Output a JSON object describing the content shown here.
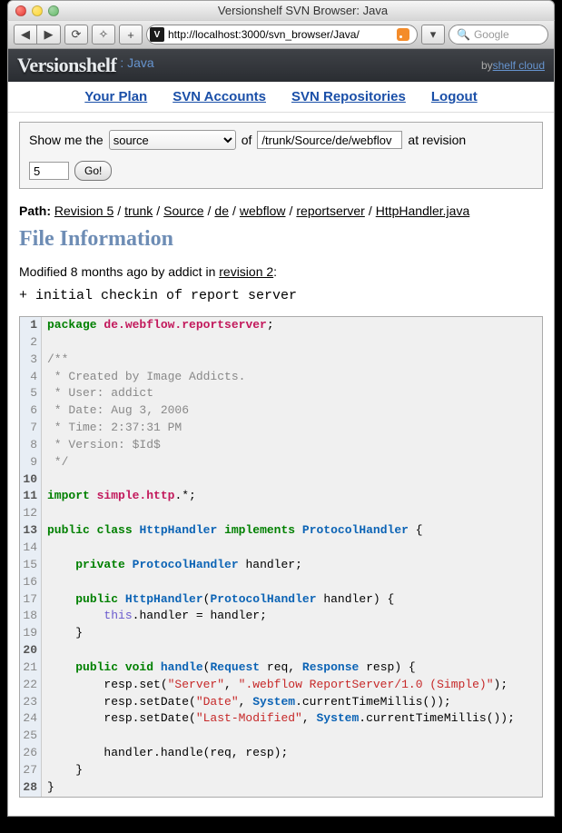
{
  "window": {
    "title": "Versionshelf SVN Browser: Java"
  },
  "toolbar": {
    "url": "http://localhost:3000/svn_browser/Java/",
    "search_placeholder": "Google"
  },
  "header": {
    "logo": "Versionshelf",
    "sub": ": Java",
    "by": "by ",
    "by_link": "shelf cloud"
  },
  "nav": {
    "plan": "Your Plan",
    "accounts": "SVN Accounts",
    "repos": "SVN Repositories",
    "logout": "Logout"
  },
  "filter": {
    "show_me": "Show me the",
    "type_options": [
      "source"
    ],
    "type_selected": "source",
    "of": "of",
    "path_value": "/trunk/Source/de/webflov",
    "at_rev": "at revision",
    "rev_value": "5",
    "go": "Go!"
  },
  "breadcrumb": {
    "label": "Path:",
    "segs": [
      "Revision 5",
      "trunk",
      "Source",
      "de",
      "webflow",
      "reportserver",
      "HttpHandler.java"
    ]
  },
  "section_title": "File Information",
  "meta": {
    "text_before": "Modified 8 months ago by addict in ",
    "rev_link": "revision 2",
    "text_after": ":"
  },
  "commit_msg": "+ initial checkin of report server",
  "code": {
    "bold_lines": [
      1,
      10,
      11,
      13,
      20,
      28
    ],
    "lines": [
      {
        "n": 1,
        "html": "<span class='kw'>package</span> <span class='pkg'>de.webflow.reportserver</span>;"
      },
      {
        "n": 2,
        "html": ""
      },
      {
        "n": 3,
        "html": "<span class='cmnt'>/**</span>"
      },
      {
        "n": 4,
        "html": "<span class='cmnt'> * Created by Image Addicts.</span>"
      },
      {
        "n": 5,
        "html": "<span class='cmnt'> * User: addict</span>"
      },
      {
        "n": 6,
        "html": "<span class='cmnt'> * Date: Aug 3, 2006</span>"
      },
      {
        "n": 7,
        "html": "<span class='cmnt'> * Time: 2:37:31 PM</span>"
      },
      {
        "n": 8,
        "html": "<span class='cmnt'> * Version: $Id$</span>"
      },
      {
        "n": 9,
        "html": "<span class='cmnt'> */</span>"
      },
      {
        "n": 10,
        "html": ""
      },
      {
        "n": 11,
        "html": "<span class='kw'>import</span> <span class='pkg'>simple.http</span>.*;"
      },
      {
        "n": 12,
        "html": ""
      },
      {
        "n": 13,
        "html": "<span class='kw'>public class</span> <span class='type'>HttpHandler</span> <span class='kw'>implements</span> <span class='type'>ProtocolHandler</span> {"
      },
      {
        "n": 14,
        "html": ""
      },
      {
        "n": 15,
        "html": "    <span class='kw'>private</span> <span class='type'>ProtocolHandler</span> handler;"
      },
      {
        "n": 16,
        "html": ""
      },
      {
        "n": 17,
        "html": "    <span class='kw'>public</span> <span class='type'>HttpHandler</span>(<span class='type'>ProtocolHandler</span> handler) {"
      },
      {
        "n": 18,
        "html": "        <span class='self'>this</span>.handler = handler;"
      },
      {
        "n": 19,
        "html": "    }"
      },
      {
        "n": 20,
        "html": ""
      },
      {
        "n": 21,
        "html": "    <span class='kw'>public void</span> <span class='type'>handle</span>(<span class='type'>Request</span> req, <span class='type'>Response</span> resp) {"
      },
      {
        "n": 22,
        "html": "        resp.set(<span class='str'>\"Server\"</span>, <span class='str'>\".webflow ReportServer/1.0 (Simple)\"</span>);"
      },
      {
        "n": 23,
        "html": "        resp.setDate(<span class='str'>\"Date\"</span>, <span class='type'>System</span>.currentTimeMillis());"
      },
      {
        "n": 24,
        "html": "        resp.setDate(<span class='str'>\"Last-Modified\"</span>, <span class='type'>System</span>.currentTimeMillis());"
      },
      {
        "n": 25,
        "html": ""
      },
      {
        "n": 26,
        "html": "        handler.handle(req, resp);"
      },
      {
        "n": 27,
        "html": "    }"
      },
      {
        "n": 28,
        "html": "}"
      }
    ]
  }
}
